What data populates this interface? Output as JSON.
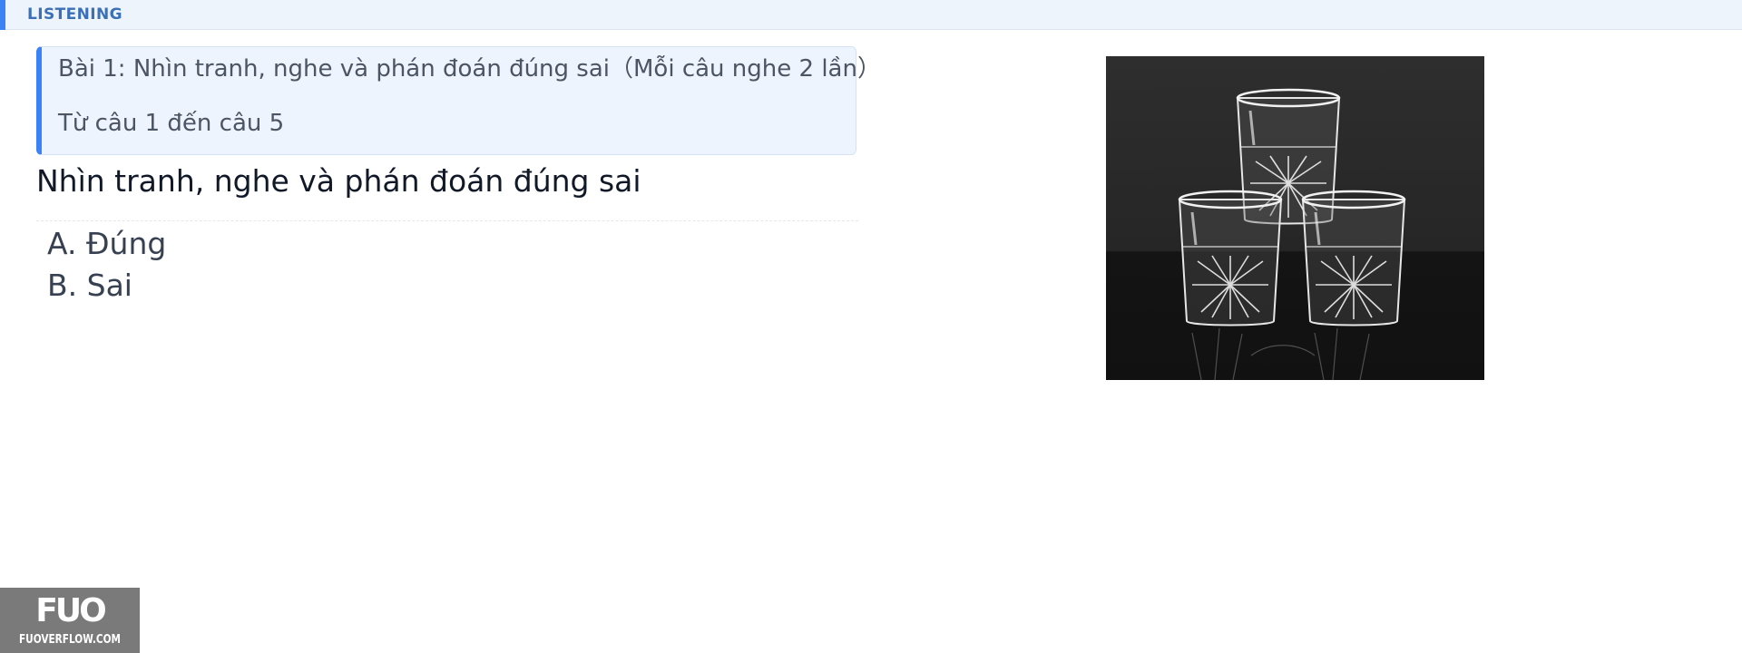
{
  "section": {
    "label": "LISTENING"
  },
  "instruction": {
    "line1": "Bài 1: Nhìn tranh, nghe và phán đoán đúng sai（Mỗi câu nghe 2 lần）",
    "line2": "Từ câu 1 đến câu 5"
  },
  "question": {
    "title": "Nhìn tranh, nghe và phán đoán đúng sai",
    "options": [
      {
        "label": "A. Đúng"
      },
      {
        "label": "B. Sai"
      }
    ]
  },
  "image": {
    "subject": "three crystal glasses stacked in a pyramid on a black background"
  },
  "watermark": {
    "logo": "FUO",
    "site": "FUOVERFLOW.COM"
  },
  "colors": {
    "accent": "#3b82f6",
    "section_bg": "#eef4fc",
    "instruction_bg": "#eef4fd",
    "watermark_bg": "#7a7a7a"
  }
}
